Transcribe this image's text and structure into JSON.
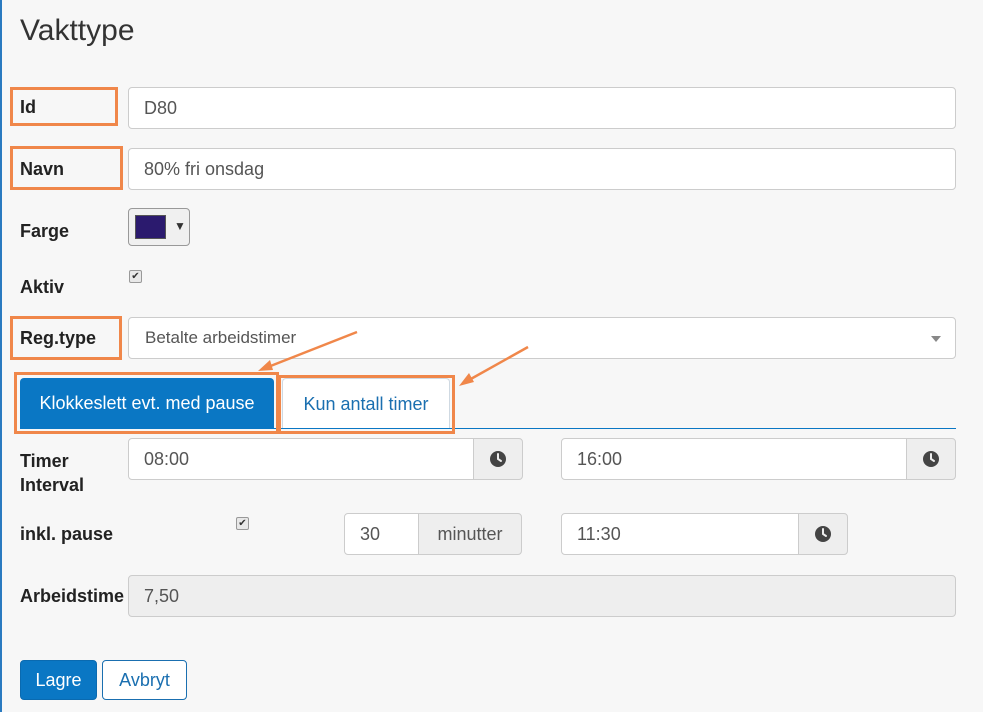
{
  "page": {
    "title": "Vakttype"
  },
  "fields": {
    "id": {
      "label": "Id",
      "value": "D80"
    },
    "navn": {
      "label": "Navn",
      "value": "80% fri onsdag"
    },
    "farge": {
      "label": "Farge",
      "color": "#2b1a6e",
      "caret": "▼"
    },
    "aktiv": {
      "label": "Aktiv",
      "checked": true
    },
    "regtype": {
      "label": "Reg.type",
      "value": "Betalte arbeidstimer"
    }
  },
  "tabs": [
    {
      "label": "Klokkeslett evt. med pause",
      "active": true
    },
    {
      "label": "Kun antall timer",
      "active": false
    }
  ],
  "timer_interval": {
    "label_line1": "Timer",
    "label_line2": "Interval",
    "start": "08:00",
    "end": "16:00",
    "icon": "clock-icon"
  },
  "pause": {
    "label": "inkl. pause",
    "checked": true,
    "minutes": "30",
    "unit": "minutter",
    "time": "11:30"
  },
  "arbeidstimer": {
    "label": "Arbeidstime",
    "value": "7,50"
  },
  "buttons": {
    "save": "Lagre",
    "cancel": "Avbryt"
  },
  "colors": {
    "accent": "#0a77c4",
    "annotation": "#f0874a",
    "swatch": "#2b1a6e"
  },
  "check_glyph": "✔"
}
